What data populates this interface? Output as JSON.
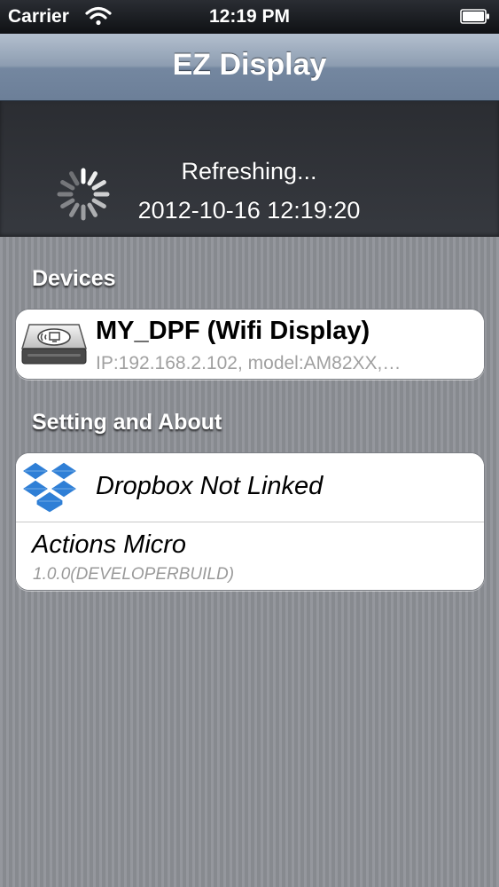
{
  "status_bar": {
    "carrier": "Carrier",
    "time": "12:19 PM"
  },
  "nav_bar": {
    "title": "EZ Display"
  },
  "refresh": {
    "status": "Refreshing...",
    "timestamp": "2012-10-16 12:19:20"
  },
  "sections": {
    "devices": {
      "header": "Devices",
      "items": [
        {
          "name": "MY_DPF (Wifi Display)",
          "detail": "IP:192.168.2.102, model:AM82XX,…",
          "icon": "wifi-display-drive-icon"
        }
      ]
    },
    "settings": {
      "header": "Setting and About",
      "dropbox_label": "Dropbox Not Linked",
      "dropbox_icon": "dropbox-icon",
      "about_title": "Actions Micro",
      "about_version": "1.0.0(DEVELOPERBUILD)"
    }
  },
  "colors": {
    "nav_bar": "#8d9db1",
    "refresh_area": "#2f3237",
    "table_background": "#8e9197",
    "dropbox_blue": "#2f7fd6"
  }
}
